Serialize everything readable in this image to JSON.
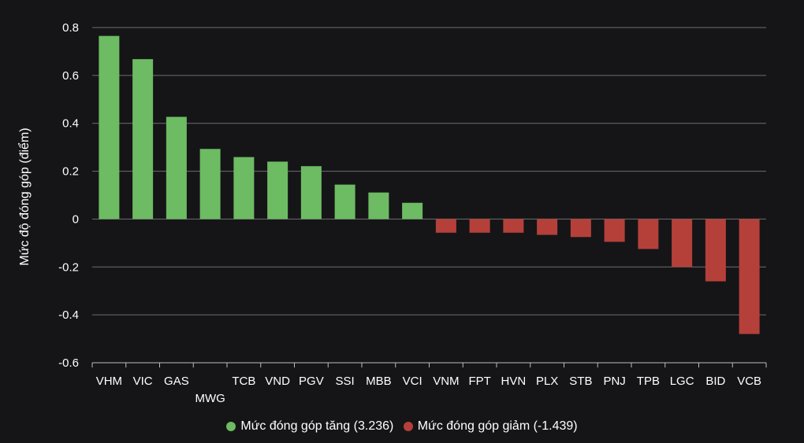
{
  "chart_data": {
    "type": "bar",
    "ylabel": "Mức độ đóng góp (điểm)",
    "ylim": [
      -0.6,
      0.8
    ],
    "yticks": [
      0.8,
      0.6,
      0.4,
      0.2,
      0,
      -0.2,
      -0.4,
      -0.6
    ],
    "ytick_labels": [
      "0.8",
      "0.6",
      "0.4",
      "0.2",
      "0",
      "-0.2",
      "-0.4",
      "-0.6"
    ],
    "grid": "horizontal",
    "legend_position": "bottom-center",
    "categories": [
      "VHM",
      "VIC",
      "GAS",
      "MWG",
      "TCB",
      "VND",
      "PGV",
      "SSI",
      "MBB",
      "VCI",
      "VNM",
      "FPT",
      "HVN",
      "PLX",
      "STB",
      "PNJ",
      "TPB",
      "LGC",
      "BID",
      "VCB"
    ],
    "values": [
      0.765,
      0.668,
      0.427,
      0.293,
      0.259,
      0.24,
      0.221,
      0.144,
      0.111,
      0.068,
      -0.057,
      -0.057,
      -0.057,
      -0.066,
      -0.075,
      -0.095,
      -0.125,
      -0.2,
      -0.26,
      -0.48
    ],
    "series": [
      {
        "name": "Mức đóng góp tăng (3.236)",
        "color": "#6dbb63"
      },
      {
        "name": "Mức đóng góp giảm (-1.439)",
        "color": "#b5403a"
      }
    ],
    "colors": {
      "positive": "#6dbb63",
      "negative": "#b5403a",
      "grid": "#6e6e72",
      "axis": "#bdbdbd",
      "text": "#ffffff",
      "background": "#151517"
    }
  }
}
